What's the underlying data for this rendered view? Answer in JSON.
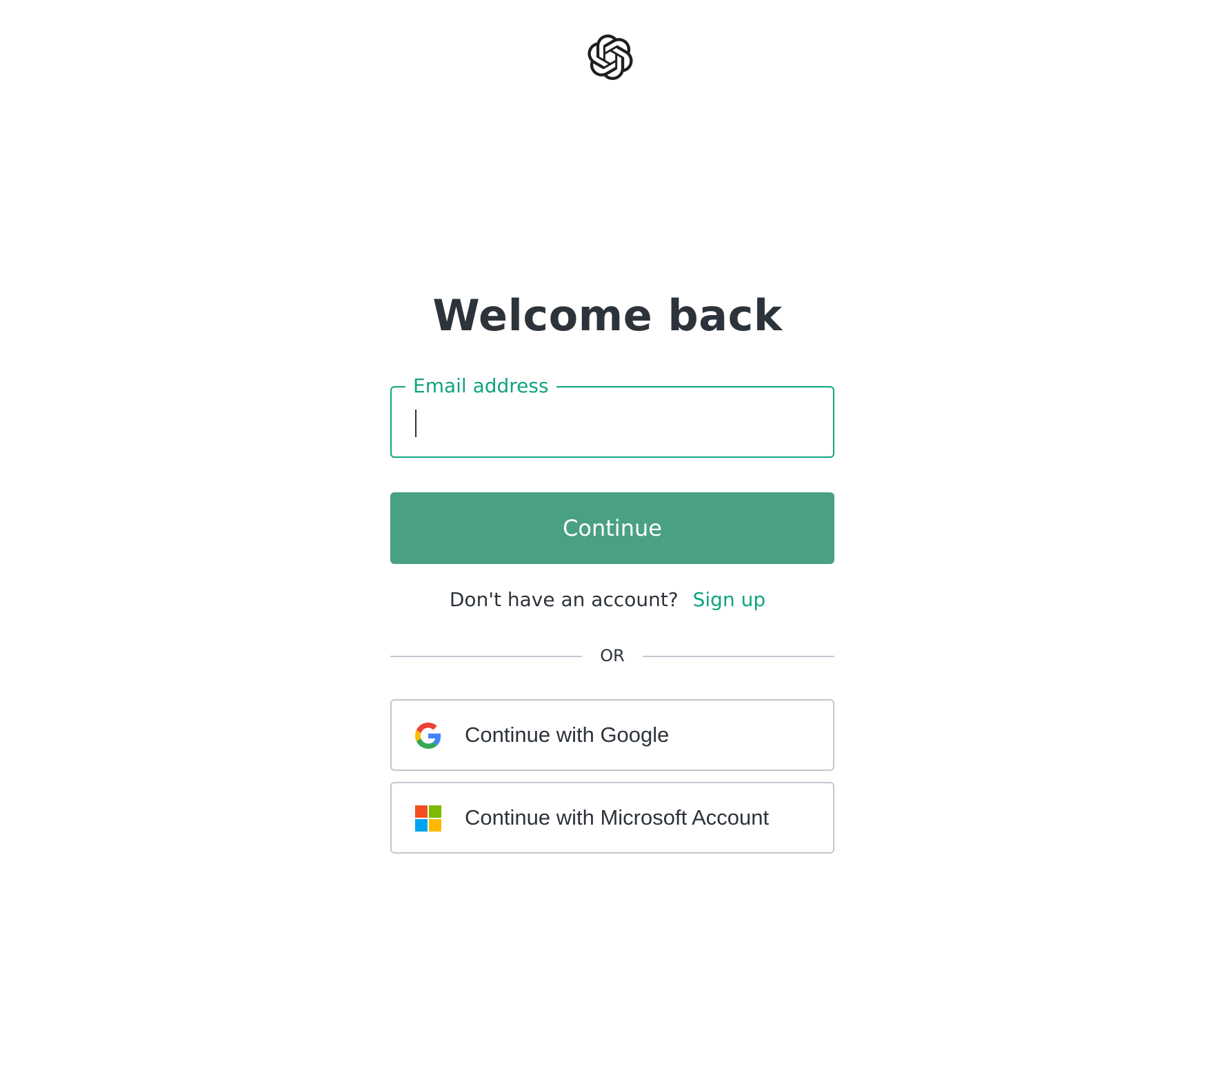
{
  "logo": {
    "icon": "openai-logo-icon"
  },
  "header": {
    "title": "Welcome back"
  },
  "email": {
    "label": "Email address",
    "value": "",
    "placeholder": ""
  },
  "continue_button": {
    "label": "Continue"
  },
  "signup": {
    "prompt": "Don't have an account?",
    "link": "Sign up"
  },
  "divider": {
    "text": "OR"
  },
  "social": {
    "google": {
      "label": "Continue with Google",
      "icon": "google-icon"
    },
    "microsoft": {
      "label": "Continue with Microsoft Account",
      "icon": "microsoft-icon"
    }
  },
  "colors": {
    "accent": "#10a37f",
    "button_bg": "#4aa181",
    "text": "#2d333a",
    "border": "#c2c8d0"
  }
}
